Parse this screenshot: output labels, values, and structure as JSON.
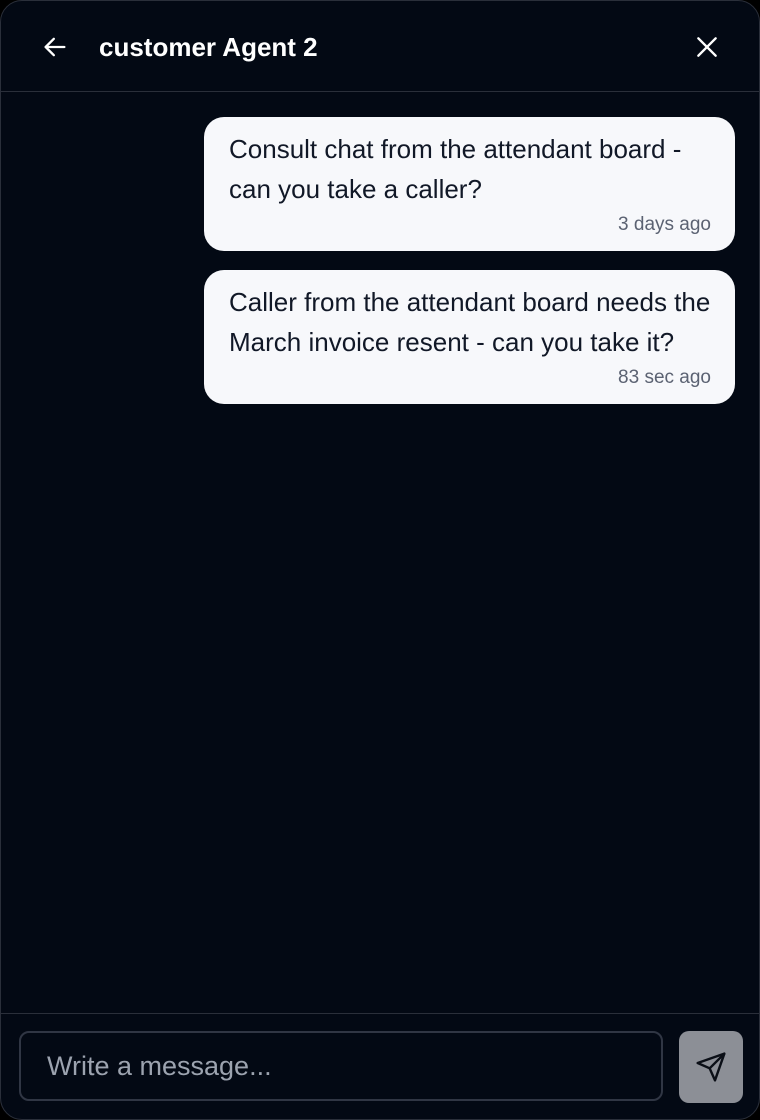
{
  "header": {
    "back_icon": "arrow-left-icon",
    "title": "customer Agent 2",
    "close_icon": "close-icon"
  },
  "messages": [
    {
      "text": "Consult chat from the attendant board - can you take a caller?",
      "time": "3 days ago"
    },
    {
      "text": "Caller from the attendant board needs the March invoice resent - can you take it?",
      "time": "83 sec ago"
    }
  ],
  "composer": {
    "placeholder": "Write a message...",
    "value": "",
    "send_icon": "send-icon"
  },
  "colors": {
    "background": "#030914",
    "bubble": "#f7f8fb",
    "send_button": "#8c8f96",
    "border": "#2a2f3a"
  }
}
